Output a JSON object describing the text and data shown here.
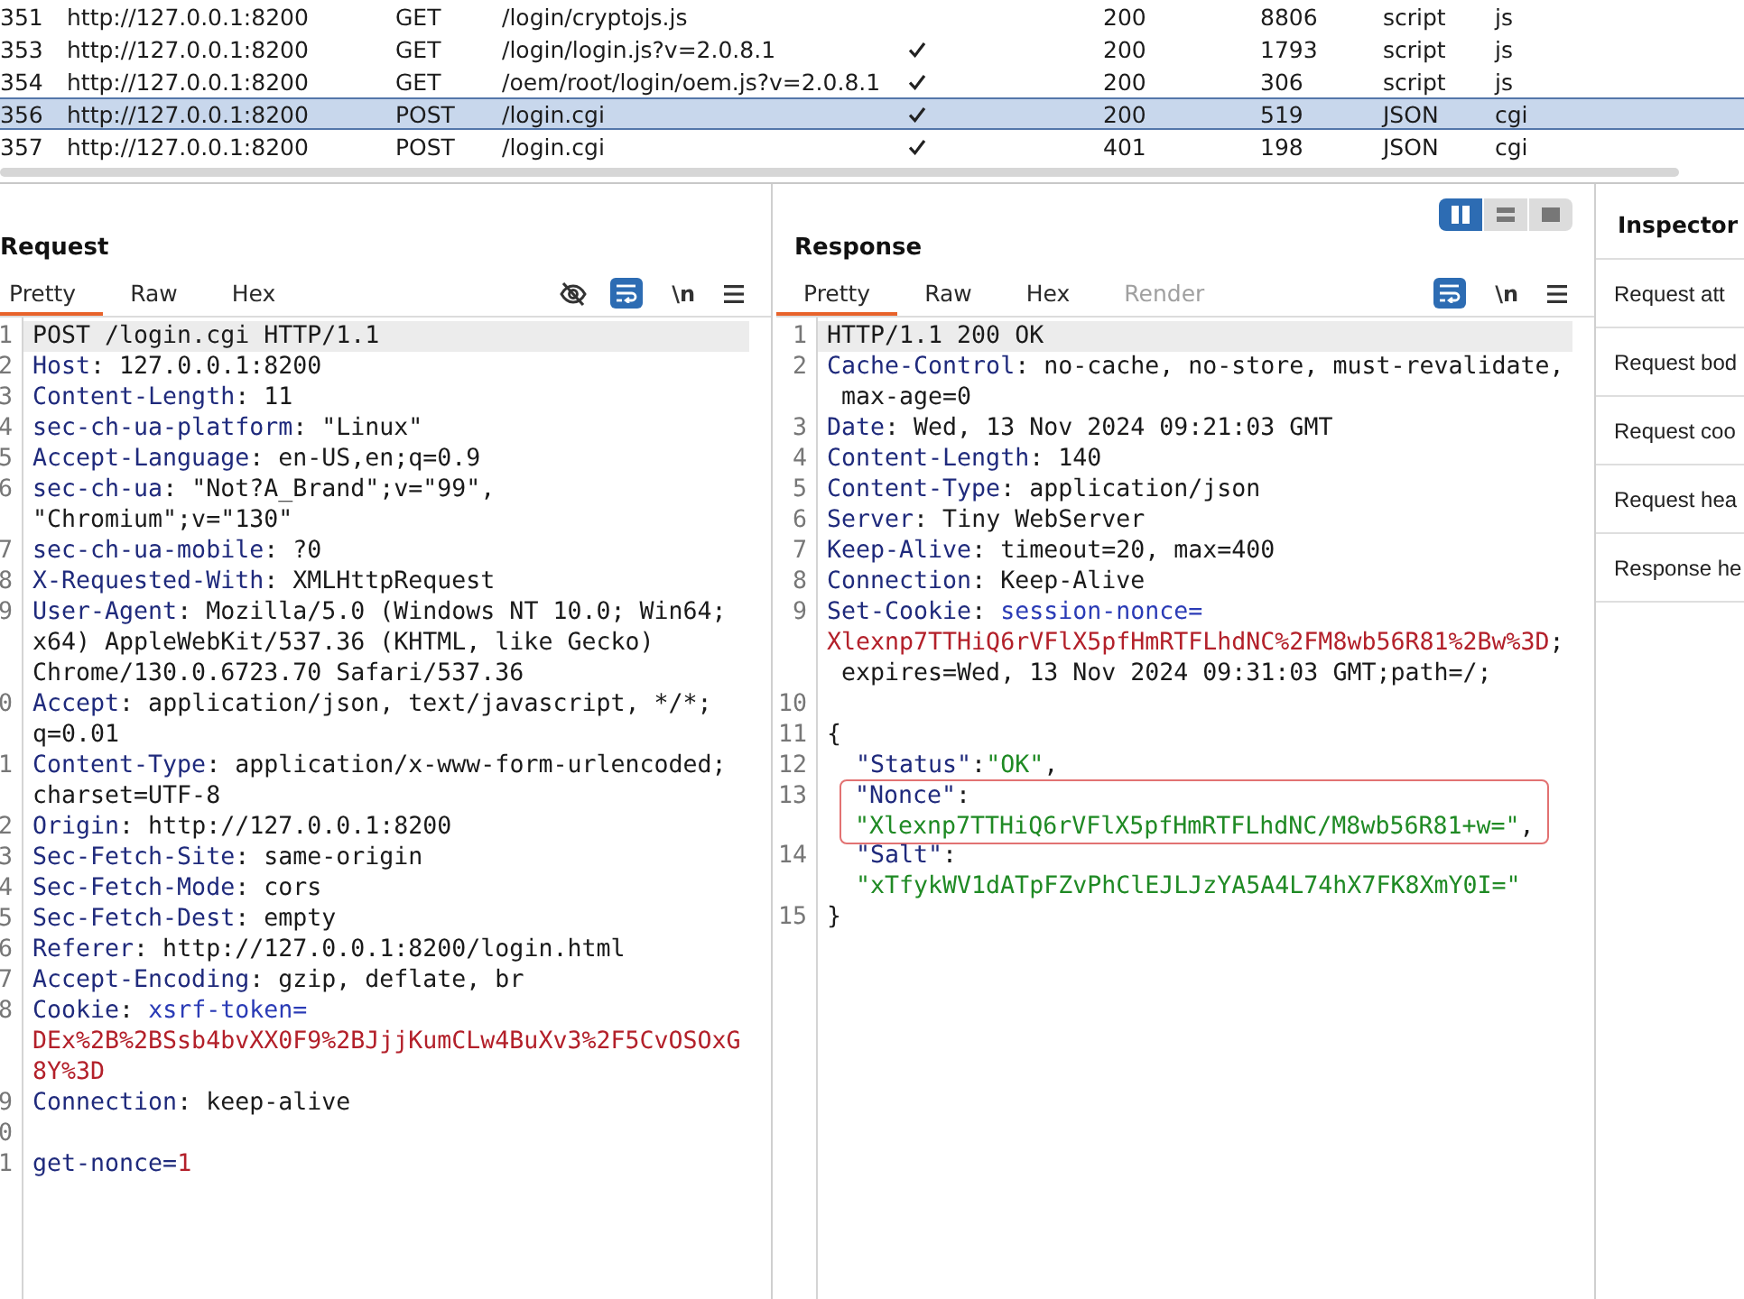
{
  "requests": [
    {
      "column_1": "351",
      "column_2": "http://127.0.0.1:8200",
      "column_3": "GET",
      "column_4": "/login/cryptojs.js",
      "checked": false,
      "column_6": "200",
      "column_7": "8806",
      "column_8": "script",
      "column_9": "js",
      "selected": false
    },
    {
      "column_1": "353",
      "column_2": "http://127.0.0.1:8200",
      "column_3": "GET",
      "column_4": "/login/login.js?v=2.0.8.1",
      "checked": true,
      "column_6": "200",
      "column_7": "1793",
      "column_8": "script",
      "column_9": "js",
      "selected": false
    },
    {
      "column_1": "354",
      "column_2": "http://127.0.0.1:8200",
      "column_3": "GET",
      "column_4": "/oem/root/login/oem.js?v=2.0.8.1",
      "checked": true,
      "column_6": "200",
      "column_7": "306",
      "column_8": "script",
      "column_9": "js",
      "selected": false
    },
    {
      "column_1": "356",
      "column_2": "http://127.0.0.1:8200",
      "column_3": "POST",
      "column_4": "/login.cgi",
      "checked": true,
      "column_6": "200",
      "column_7": "519",
      "column_8": "JSON",
      "column_9": "cgi",
      "selected": true
    },
    {
      "column_1": "357",
      "column_2": "http://127.0.0.1:8200",
      "column_3": "POST",
      "column_4": "/login.cgi",
      "checked": true,
      "column_6": "401",
      "column_7": "198",
      "column_8": "JSON",
      "column_9": "cgi",
      "selected": false
    }
  ],
  "request": {
    "title": "Request",
    "tabs": [
      {
        "label": "Pretty",
        "selected": true
      },
      {
        "label": "Raw",
        "selected": false
      },
      {
        "label": "Hex",
        "selected": false
      }
    ],
    "toolbar": [
      {
        "kind": "hide",
        "on": false
      },
      {
        "kind": "wrap",
        "on": true
      },
      {
        "kind": "newline",
        "label": "\\n",
        "on": false
      },
      {
        "kind": "menu",
        "on": false
      }
    ],
    "lines": [
      {
        "number": "1",
        "current": true,
        "rows": [
          {
            "segments": [
              {
                "kind": "plain",
                "text": "POST /login.cgi HTTP/1.1"
              }
            ]
          }
        ]
      },
      {
        "number": "2",
        "current": false,
        "rows": [
          {
            "segments": [
              {
                "kind": "name",
                "text": "Host"
              },
              {
                "kind": "plain",
                "text": ": 127.0.0.1:8200"
              }
            ]
          }
        ]
      },
      {
        "number": "3",
        "current": false,
        "rows": [
          {
            "segments": [
              {
                "kind": "name",
                "text": "Content-Length"
              },
              {
                "kind": "plain",
                "text": ": 11"
              }
            ]
          }
        ]
      },
      {
        "number": "4",
        "current": false,
        "rows": [
          {
            "segments": [
              {
                "kind": "name",
                "text": "sec-ch-ua-platform"
              },
              {
                "kind": "plain",
                "text": ": \"Linux\""
              }
            ]
          }
        ]
      },
      {
        "number": "5",
        "current": false,
        "rows": [
          {
            "segments": [
              {
                "kind": "name",
                "text": "Accept-Language"
              },
              {
                "kind": "plain",
                "text": ": en-US,en;q=0.9"
              }
            ]
          }
        ]
      },
      {
        "number": "6",
        "current": false,
        "rows": [
          {
            "segments": [
              {
                "kind": "name",
                "text": "sec-ch-ua"
              },
              {
                "kind": "plain",
                "text": ": \"Not?A_Brand\";v=\"99\","
              }
            ]
          },
          {
            "segments": [
              {
                "kind": "plain",
                "text": "\"Chromium\";v=\"130\""
              }
            ]
          }
        ]
      },
      {
        "number": "7",
        "current": false,
        "rows": [
          {
            "segments": [
              {
                "kind": "name",
                "text": "sec-ch-ua-mobile"
              },
              {
                "kind": "plain",
                "text": ": ?0"
              }
            ]
          }
        ]
      },
      {
        "number": "8",
        "current": false,
        "rows": [
          {
            "segments": [
              {
                "kind": "name",
                "text": "X-Requested-With"
              },
              {
                "kind": "plain",
                "text": ": XMLHttpRequest"
              }
            ]
          }
        ]
      },
      {
        "number": "9",
        "current": false,
        "rows": [
          {
            "segments": [
              {
                "kind": "name",
                "text": "User-Agent"
              },
              {
                "kind": "plain",
                "text": ": Mozilla/5.0 (Windows NT 10.0; Win64;"
              }
            ]
          },
          {
            "segments": [
              {
                "kind": "plain",
                "text": "x64) AppleWebKit/537.36 (KHTML, like Gecko)"
              }
            ]
          },
          {
            "segments": [
              {
                "kind": "plain",
                "text": "Chrome/130.0.6723.70 Safari/537.36"
              }
            ]
          }
        ]
      },
      {
        "number": "0",
        "current": false,
        "rows": [
          {
            "segments": [
              {
                "kind": "name",
                "text": "Accept"
              },
              {
                "kind": "plain",
                "text": ": application/json, text/javascript, */*;"
              }
            ]
          },
          {
            "segments": [
              {
                "kind": "plain",
                "text": "q=0.01"
              }
            ]
          }
        ]
      },
      {
        "number": "1",
        "current": false,
        "rows": [
          {
            "segments": [
              {
                "kind": "name",
                "text": "Content-Type"
              },
              {
                "kind": "plain",
                "text": ": application/x-www-form-urlencoded;"
              }
            ]
          },
          {
            "segments": [
              {
                "kind": "plain",
                "text": "charset=UTF-8"
              }
            ]
          }
        ]
      },
      {
        "number": "2",
        "current": false,
        "rows": [
          {
            "segments": [
              {
                "kind": "name",
                "text": "Origin"
              },
              {
                "kind": "plain",
                "text": ": http://127.0.0.1:8200"
              }
            ]
          }
        ]
      },
      {
        "number": "3",
        "current": false,
        "rows": [
          {
            "segments": [
              {
                "kind": "name",
                "text": "Sec-Fetch-Site"
              },
              {
                "kind": "plain",
                "text": ": same-origin"
              }
            ]
          }
        ]
      },
      {
        "number": "4",
        "current": false,
        "rows": [
          {
            "segments": [
              {
                "kind": "name",
                "text": "Sec-Fetch-Mode"
              },
              {
                "kind": "plain",
                "text": ": cors"
              }
            ]
          }
        ]
      },
      {
        "number": "5",
        "current": false,
        "rows": [
          {
            "segments": [
              {
                "kind": "name",
                "text": "Sec-Fetch-Dest"
              },
              {
                "kind": "plain",
                "text": ": empty"
              }
            ]
          }
        ]
      },
      {
        "number": "6",
        "current": false,
        "rows": [
          {
            "segments": [
              {
                "kind": "name",
                "text": "Referer"
              },
              {
                "kind": "plain",
                "text": ": http://127.0.0.1:8200/login.html"
              }
            ]
          }
        ]
      },
      {
        "number": "7",
        "current": false,
        "rows": [
          {
            "segments": [
              {
                "kind": "name",
                "text": "Accept-Encoding"
              },
              {
                "kind": "plain",
                "text": ": gzip, deflate, br"
              }
            ]
          }
        ]
      },
      {
        "number": "8",
        "current": false,
        "rows": [
          {
            "segments": [
              {
                "kind": "name",
                "text": "Cookie"
              },
              {
                "kind": "plain",
                "text": ": "
              },
              {
                "kind": "attr",
                "text": "xsrf-token="
              }
            ]
          },
          {
            "segments": [
              {
                "kind": "value",
                "text": "DEx%2B%2BSsb4bvXX0F9%2BJjjKumCLw4BuXv3%2F5CvOSOxG"
              }
            ]
          },
          {
            "segments": [
              {
                "kind": "value",
                "text": "8Y%3D"
              }
            ]
          }
        ]
      },
      {
        "number": "9",
        "current": false,
        "rows": [
          {
            "segments": [
              {
                "kind": "name",
                "text": "Connection"
              },
              {
                "kind": "plain",
                "text": ": keep-alive"
              }
            ]
          }
        ]
      },
      {
        "number": "0",
        "current": false
      },
      {
        "number": "1",
        "current": false,
        "rows": [
          {
            "segments": [
              {
                "kind": "name",
                "text": "get-nonce="
              },
              {
                "kind": "value",
                "text": "1"
              }
            ]
          }
        ]
      }
    ]
  },
  "response": {
    "view_modes": [
      {
        "kind": "side-by-side",
        "selected": true
      },
      {
        "kind": "stacked",
        "selected": false
      },
      {
        "kind": "single",
        "selected": false
      }
    ],
    "title": "Response",
    "tabs": [
      {
        "label": "Pretty",
        "selected": true,
        "disabled": false
      },
      {
        "label": "Raw",
        "selected": false,
        "disabled": false
      },
      {
        "label": "Hex",
        "selected": false,
        "disabled": false
      },
      {
        "label": "Render",
        "selected": false,
        "disabled": true
      }
    ],
    "toolbar": [
      {
        "kind": "wrap",
        "on": true
      },
      {
        "kind": "newline",
        "label": "\\n",
        "on": false
      },
      {
        "kind": "menu",
        "on": false
      }
    ],
    "lines": [
      {
        "number": "1",
        "current": true,
        "highlighted": false,
        "rows": [
          {
            "segments": [
              {
                "kind": "plain",
                "text": "HTTP/1.1 200 OK"
              }
            ]
          }
        ]
      },
      {
        "number": "2",
        "current": false,
        "highlighted": false,
        "rows": [
          {
            "segments": [
              {
                "kind": "name",
                "text": "Cache-Control"
              },
              {
                "kind": "plain",
                "text": ": no-cache, no-store, must-revalidate,"
              }
            ]
          },
          {
            "segments": [
              {
                "kind": "plain",
                "text": " max-age=0"
              }
            ]
          }
        ]
      },
      {
        "number": "3",
        "current": false,
        "highlighted": false,
        "rows": [
          {
            "segments": [
              {
                "kind": "name",
                "text": "Date"
              },
              {
                "kind": "plain",
                "text": ": Wed, 13 Nov 2024 09:21:03 GMT"
              }
            ]
          }
        ]
      },
      {
        "number": "4",
        "current": false,
        "highlighted": false,
        "rows": [
          {
            "segments": [
              {
                "kind": "name",
                "text": "Content-Length"
              },
              {
                "kind": "plain",
                "text": ": 140"
              }
            ]
          }
        ]
      },
      {
        "number": "5",
        "current": false,
        "highlighted": false,
        "rows": [
          {
            "segments": [
              {
                "kind": "name",
                "text": "Content-Type"
              },
              {
                "kind": "plain",
                "text": ": application/json"
              }
            ]
          }
        ]
      },
      {
        "number": "6",
        "current": false,
        "highlighted": false,
        "rows": [
          {
            "segments": [
              {
                "kind": "name",
                "text": "Server"
              },
              {
                "kind": "plain",
                "text": ": Tiny WebServer"
              }
            ]
          }
        ]
      },
      {
        "number": "7",
        "current": false,
        "highlighted": false,
        "rows": [
          {
            "segments": [
              {
                "kind": "name",
                "text": "Keep-Alive"
              },
              {
                "kind": "plain",
                "text": ": timeout=20, max=400"
              }
            ]
          }
        ]
      },
      {
        "number": "8",
        "current": false,
        "highlighted": false,
        "rows": [
          {
            "segments": [
              {
                "kind": "name",
                "text": "Connection"
              },
              {
                "kind": "plain",
                "text": ": Keep-Alive"
              }
            ]
          }
        ]
      },
      {
        "number": "9",
        "current": false,
        "highlighted": false,
        "rows": [
          {
            "segments": [
              {
                "kind": "name",
                "text": "Set-Cookie"
              },
              {
                "kind": "plain",
                "text": ": "
              },
              {
                "kind": "attr",
                "text": "session-nonce="
              }
            ]
          },
          {
            "segments": [
              {
                "kind": "value",
                "text": "Xlexnp7TTHiQ6rVFlX5pfHmRTFLhdNC%2FM8wb56R81%2Bw%3D"
              },
              {
                "kind": "plain",
                "text": ";"
              }
            ]
          },
          {
            "segments": [
              {
                "kind": "plain",
                "text": " expires=Wed, 13 Nov 2024 09:31:03 GMT;path=/;"
              }
            ]
          }
        ]
      },
      {
        "number": "10",
        "current": false,
        "highlighted": false
      },
      {
        "number": "11",
        "current": false,
        "highlighted": false,
        "rows": [
          {
            "segments": [
              {
                "kind": "plain",
                "text": "{"
              }
            ]
          }
        ],
        "children": [
          {
            "number": "12",
            "current": false,
            "highlighted": false,
            "rows": [
              {
                "segments": [
                  {
                    "kind": "name",
                    "text": "\"Status\""
                  },
                  {
                    "kind": "plain",
                    "text": ":"
                  },
                  {
                    "kind": "string",
                    "text": "\"OK\""
                  },
                  {
                    "kind": "plain",
                    "text": ","
                  }
                ]
              }
            ]
          },
          {
            "number": "13",
            "current": false,
            "highlighted": true,
            "rows": [
              {
                "segments": [
                  {
                    "kind": "name",
                    "text": "\"Nonce\""
                  },
                  {
                    "kind": "plain",
                    "text": ":"
                  }
                ]
              },
              {
                "segments": [
                  {
                    "kind": "string",
                    "text": "\"Xlexnp7TTHiQ6rVFlX5pfHmRTFLhdNC/M8wb56R81+w=\""
                  },
                  {
                    "kind": "plain",
                    "text": ","
                  }
                ]
              }
            ]
          },
          {
            "number": "14",
            "current": false,
            "highlighted": false,
            "rows": [
              {
                "segments": [
                  {
                    "kind": "name",
                    "text": "\"Salt\""
                  },
                  {
                    "kind": "plain",
                    "text": ":"
                  }
                ]
              },
              {
                "segments": [
                  {
                    "kind": "string",
                    "text": "\"xTfykWV1dATpFZvPhClEJLJzYA5A4L74hX7FK8XmY0I=\""
                  }
                ]
              }
            ]
          }
        ]
      },
      {
        "number": "15",
        "current": false,
        "highlighted": false,
        "rows": [
          {
            "segments": [
              {
                "kind": "plain",
                "text": "}"
              }
            ]
          }
        ]
      }
    ]
  },
  "inspector": {
    "title": "Inspector",
    "sections": [
      "Request att",
      "Request bod",
      "Request coo",
      "Request hea",
      "Response he"
    ]
  }
}
